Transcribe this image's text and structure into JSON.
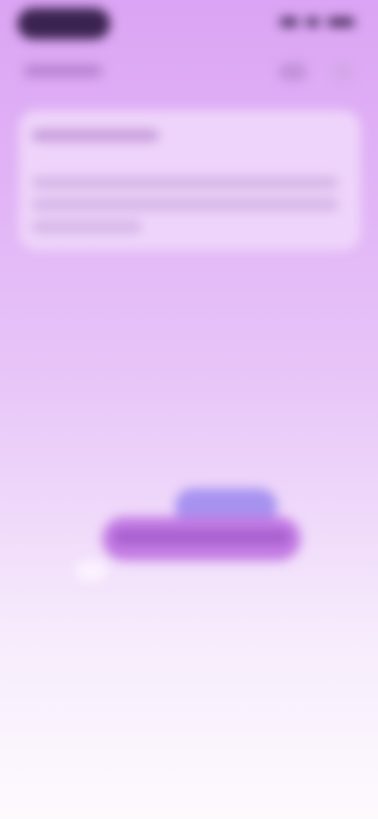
{
  "status_bar": {
    "time": "",
    "battery": ""
  },
  "header": {
    "label": ""
  },
  "card": {
    "title": "",
    "body_lines": [
      "",
      "",
      ""
    ]
  },
  "illustration": {
    "cta_label": ""
  },
  "colors": {
    "top": "#dba4f4",
    "bottom": "#fdfafe",
    "accent_purple": "#c27ae3",
    "accent_blue": "#a792f0"
  }
}
